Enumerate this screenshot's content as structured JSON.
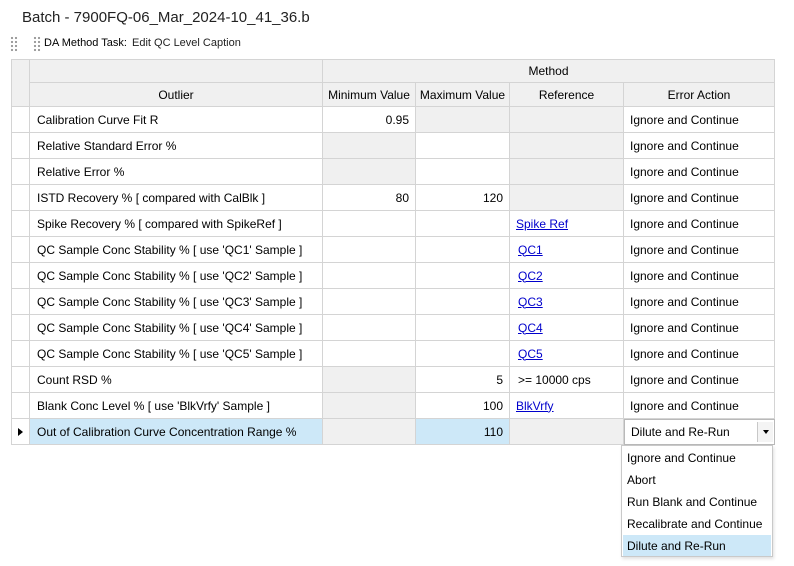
{
  "window": {
    "title": "Batch - 7900FQ-06_Mar_2024-10_41_36.b"
  },
  "taskbar": {
    "label": "DA Method Task:",
    "value": "Edit QC Level Caption"
  },
  "grid": {
    "group_header": "Method",
    "columns": [
      "Outlier",
      "Minimum Value",
      "Maximum Value",
      "Reference",
      "Error Action"
    ],
    "rows": [
      {
        "outlier": "Calibration Curve Fit R",
        "min": "0.95",
        "max": "",
        "reference": "",
        "error": "Ignore and Continue"
      },
      {
        "outlier": "Relative Standard Error %",
        "min": "",
        "max": "",
        "reference": "",
        "error": "Ignore and Continue"
      },
      {
        "outlier": "Relative Error %",
        "min": "",
        "max": "",
        "reference": "",
        "error": "Ignore and Continue"
      },
      {
        "outlier": "ISTD Recovery %  [ compared with CalBlk ]",
        "min": "80",
        "max": "120",
        "reference": "",
        "error": "Ignore and Continue"
      },
      {
        "outlier": "Spike Recovery %  [ compared with SpikeRef ]",
        "min": "",
        "max": "",
        "reference": "Spike Ref",
        "error": "Ignore and Continue"
      },
      {
        "outlier": "QC Sample Conc Stability % [ use 'QC1' Sample ]",
        "min": "",
        "max": "",
        "reference": "QC1",
        "error": "Ignore and Continue"
      },
      {
        "outlier": "QC Sample Conc Stability % [ use 'QC2' Sample ]",
        "min": "",
        "max": "",
        "reference": "QC2",
        "error": "Ignore and Continue"
      },
      {
        "outlier": "QC Sample Conc Stability % [ use 'QC3' Sample ]",
        "min": "",
        "max": "",
        "reference": "QC3",
        "error": "Ignore and Continue"
      },
      {
        "outlier": "QC Sample Conc Stability % [ use 'QC4' Sample ]",
        "min": "",
        "max": "",
        "reference": "QC4",
        "error": "Ignore and Continue"
      },
      {
        "outlier": "QC Sample Conc Stability % [ use 'QC5' Sample ]",
        "min": "",
        "max": "",
        "reference": "QC5",
        "error": "Ignore and Continue"
      },
      {
        "outlier": "Count RSD %",
        "min": "",
        "max": "5",
        "reference": ">= 10000 cps",
        "error": "Ignore and Continue"
      },
      {
        "outlier": "Blank Conc Level % [ use 'BlkVrfy' Sample ]",
        "min": "",
        "max": "100",
        "reference": "BlkVrfy",
        "error": "Ignore and Continue"
      },
      {
        "outlier": "Out of Calibration Curve Concentration Range %",
        "min": "",
        "max": "110",
        "reference": "",
        "error": "Dilute and Re-Run"
      }
    ]
  },
  "dropdown": {
    "options": [
      "Ignore and Continue",
      "Abort",
      "Run Blank and Continue",
      "Recalibrate and Continue",
      "Dilute and Re-Run"
    ],
    "selected": "Dilute and Re-Run"
  },
  "colors": {
    "selection": "#cde8f8",
    "header_bg": "#f0f0f0",
    "disabled_bg": "#f0f0f0",
    "link": "#0000cc"
  }
}
